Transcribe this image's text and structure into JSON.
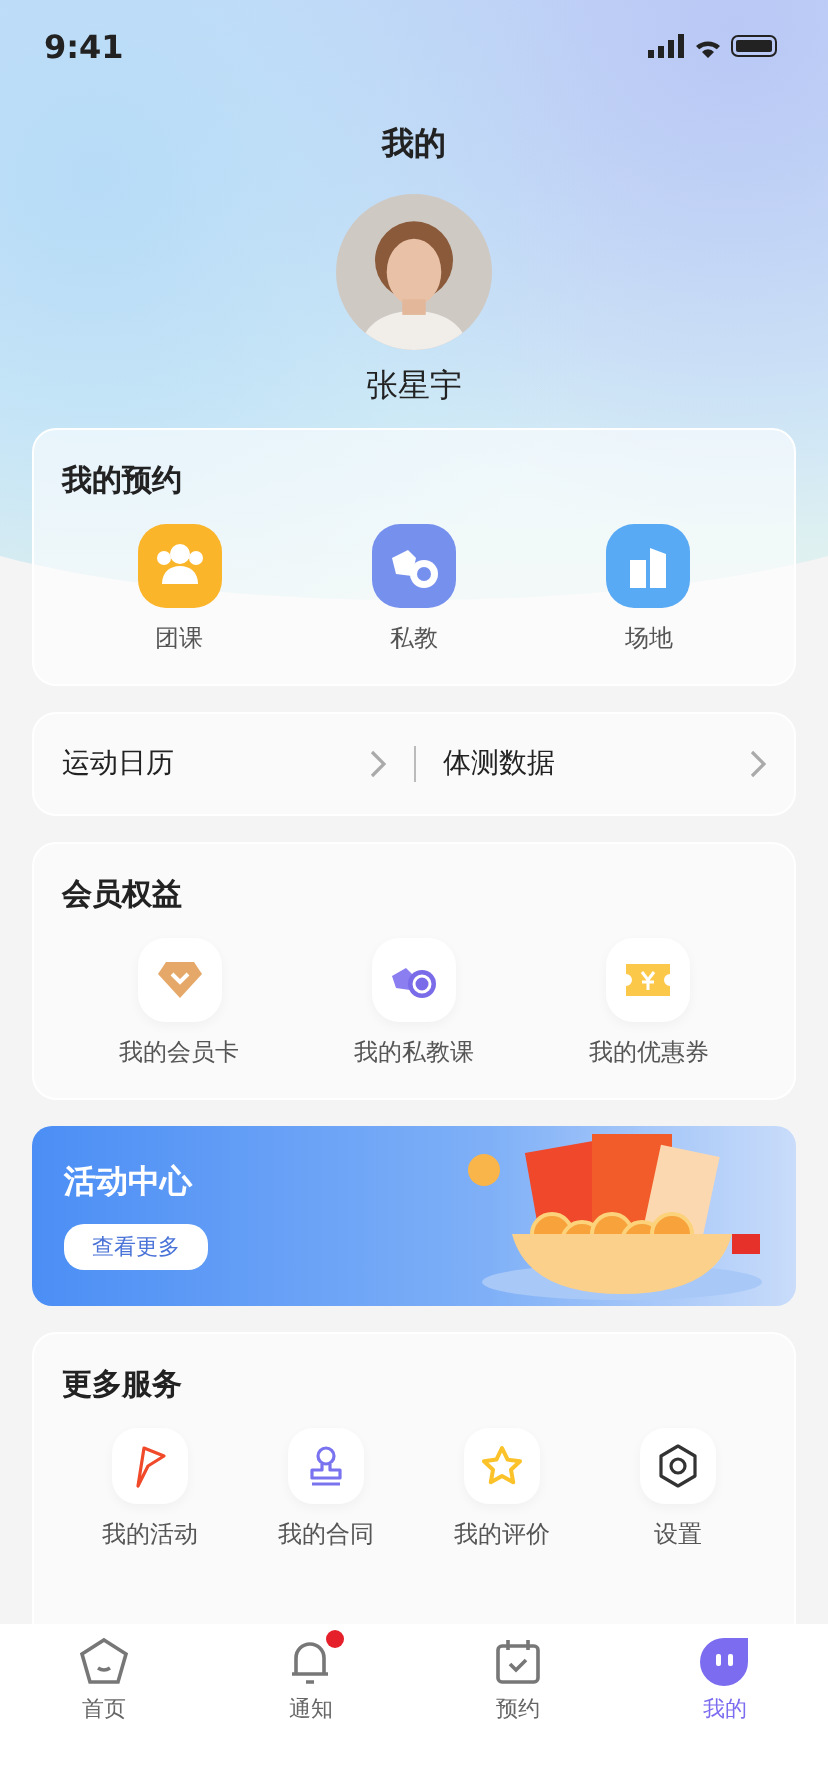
{
  "status_bar": {
    "time": "9:41"
  },
  "header": {
    "title": "我的",
    "user_name": "张星宇"
  },
  "bookings": {
    "title": "我的预约",
    "items": [
      {
        "label": "团课",
        "kind": "group"
      },
      {
        "label": "私教",
        "kind": "coach"
      },
      {
        "label": "场地",
        "kind": "venue"
      }
    ]
  },
  "quick_links": [
    {
      "label": "运动日历"
    },
    {
      "label": "体测数据"
    }
  ],
  "benefits": {
    "title": "会员权益",
    "items": [
      {
        "label": "我的会员卡",
        "kind": "card"
      },
      {
        "label": "我的私教课",
        "kind": "coach"
      },
      {
        "label": "我的优惠券",
        "kind": "coupon"
      }
    ]
  },
  "banner": {
    "title": "活动中心",
    "button": "查看更多"
  },
  "services": {
    "title": "更多服务",
    "items": [
      {
        "label": "我的活动",
        "kind": "flag"
      },
      {
        "label": "我的合同",
        "kind": "stamp"
      },
      {
        "label": "我的评价",
        "kind": "star"
      },
      {
        "label": "设置",
        "kind": "settings"
      }
    ]
  },
  "tab_bar": [
    {
      "label": "首页",
      "kind": "home",
      "selected": false,
      "badge": false
    },
    {
      "label": "通知",
      "kind": "bell",
      "selected": false,
      "badge": true
    },
    {
      "label": "预约",
      "kind": "calendar",
      "selected": false,
      "badge": false
    },
    {
      "label": "我的",
      "kind": "me",
      "selected": true,
      "badge": false
    }
  ]
}
